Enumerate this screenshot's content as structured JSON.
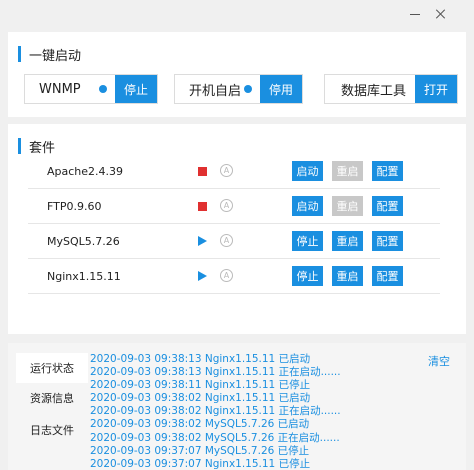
{
  "window": {
    "minimize_icon": "minimize-icon",
    "close_icon": "close-icon"
  },
  "quick_start": {
    "title": "一键启动",
    "items": [
      {
        "label": "WNMP",
        "status_color": "#1a8fe0",
        "button": "停止"
      },
      {
        "label": "开机自启",
        "status_color": "#1a8fe0",
        "button": "停用"
      },
      {
        "label": "数据库工具",
        "button": "打开"
      }
    ]
  },
  "suite": {
    "title": "套件",
    "rows": [
      {
        "name": "Apache2.4.39",
        "state": "stopped",
        "auto_icon": "A",
        "btn_start": "启动",
        "btn_restart": "重启",
        "btn_config": "配置"
      },
      {
        "name": "FTP0.9.60",
        "state": "stopped",
        "auto_icon": "A",
        "btn_start": "启动",
        "btn_restart": "重启",
        "btn_config": "配置"
      },
      {
        "name": "MySQL5.7.26",
        "state": "running",
        "auto_icon": "A",
        "btn_start": "停止",
        "btn_restart": "重启",
        "btn_config": "配置"
      },
      {
        "name": "Nginx1.15.11",
        "state": "running",
        "auto_icon": "A",
        "btn_start": "停止",
        "btn_restart": "重启",
        "btn_config": "配置"
      }
    ]
  },
  "bottom": {
    "tabs": [
      "运行状态",
      "资源信息",
      "日志文件"
    ],
    "active_tab": 0,
    "clear_label": "清空",
    "log": [
      "2020-09-03 09:38:13 Nginx1.15.11 已启动",
      "2020-09-03 09:38:13 Nginx1.15.11 正在启动......",
      "2020-09-03 09:38:11 Nginx1.15.11 已停止",
      "2020-09-03 09:38:02 Nginx1.15.11 已启动",
      "2020-09-03 09:38:02 Nginx1.15.11 正在启动......",
      "2020-09-03 09:38:02 MySQL5.7.26 已启动",
      "2020-09-03 09:38:02 MySQL5.7.26 正在启动......",
      "2020-09-03 09:37:07 MySQL5.7.26 已停止",
      "2020-09-03 09:37:07 Nginx1.15.11 已停止"
    ]
  }
}
